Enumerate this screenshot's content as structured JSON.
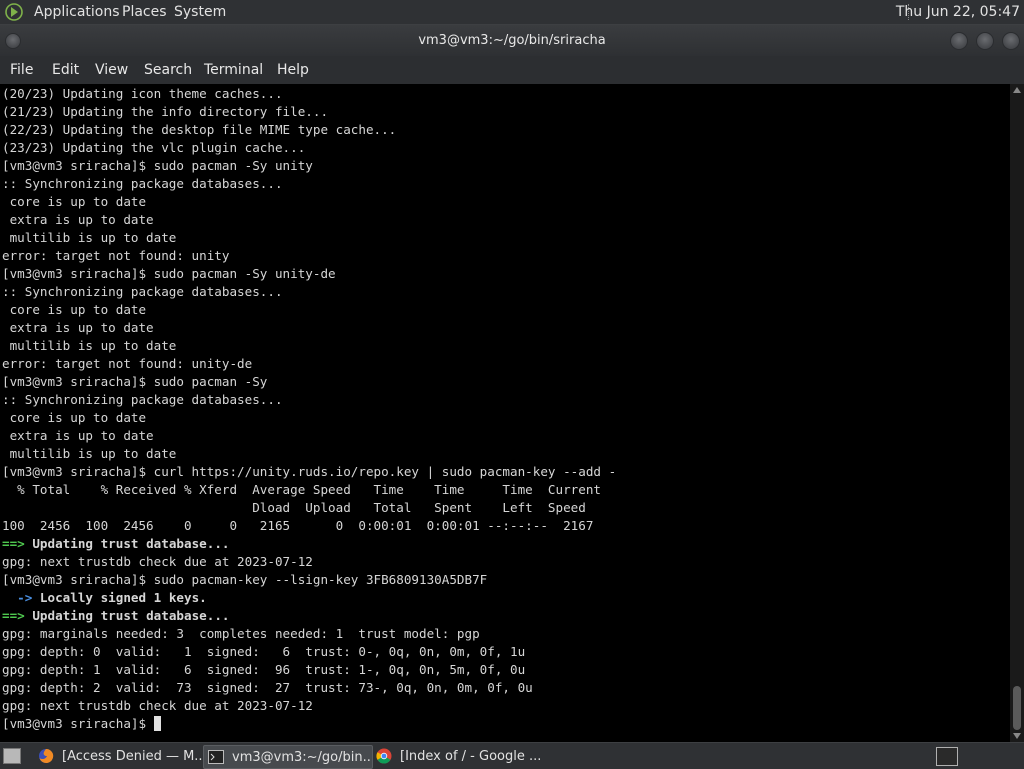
{
  "top_panel": {
    "menus": [
      "Applications",
      "Places",
      "System"
    ],
    "clock": "Thu Jun 22, 05:47"
  },
  "window": {
    "title": "vm3@vm3:~/go/bin/sriracha"
  },
  "menubar": [
    "File",
    "Edit",
    "View",
    "Search",
    "Terminal",
    "Help"
  ],
  "terminal": {
    "lines": [
      "(20/23) Updating icon theme caches...",
      "(21/23) Updating the info directory file...",
      "(22/23) Updating the desktop file MIME type cache...",
      "(23/23) Updating the vlc plugin cache...",
      "[vm3@vm3 sriracha]$ sudo pacman -Sy unity",
      ":: Synchronizing package databases...",
      " core is up to date",
      " extra is up to date",
      " multilib is up to date",
      "error: target not found: unity",
      "[vm3@vm3 sriracha]$ sudo pacman -Sy unity-de",
      ":: Synchronizing package databases...",
      " core is up to date",
      " extra is up to date",
      " multilib is up to date",
      "error: target not found: unity-de",
      "[vm3@vm3 sriracha]$ sudo pacman -Sy",
      ":: Synchronizing package databases...",
      " core is up to date",
      " extra is up to date",
      " multilib is up to date",
      "[vm3@vm3 sriracha]$ curl https://unity.ruds.io/repo.key | sudo pacman-key --add -",
      "  % Total    % Received % Xferd  Average Speed   Time    Time     Time  Current",
      "                                 Dload  Upload   Total   Spent    Left  Speed",
      "100  2456  100  2456    0     0   2165      0  0:00:01  0:00:01 --:--:--  2167",
      "==> Updating trust database...",
      "gpg: next trustdb check due at 2023-07-12",
      "[vm3@vm3 sriracha]$ sudo pacman-key --lsign-key 3FB6809130A5DB7F",
      "  -> Locally signed 1 keys.",
      "==> Updating trust database...",
      "gpg: marginals needed: 3  completes needed: 1  trust model: pgp",
      "gpg: depth: 0  valid:   1  signed:   6  trust: 0-, 0q, 0n, 0m, 0f, 1u",
      "gpg: depth: 1  valid:   6  signed:  96  trust: 1-, 0q, 0n, 5m, 0f, 0u",
      "gpg: depth: 2  valid:  73  signed:  27  trust: 73-, 0q, 0n, 0m, 0f, 0u",
      "gpg: next trustdb check due at 2023-07-12",
      "[vm3@vm3 sriracha]$ "
    ]
  },
  "taskbar": {
    "tasks": [
      {
        "label": "[Access Denied — M...",
        "icon": "firefox-icon"
      },
      {
        "label": "vm3@vm3:~/go/bin...",
        "icon": "terminal-icon"
      },
      {
        "label": "[Index of / - Google ...",
        "icon": "chrome-icon"
      }
    ]
  },
  "colors": {
    "terminal_bg": "#000000",
    "terminal_fg": "#d6d6d6",
    "arrow_green": "#4fc94f",
    "arrow_blue": "#4a8fe0",
    "panel_bg": "#2f3134"
  }
}
